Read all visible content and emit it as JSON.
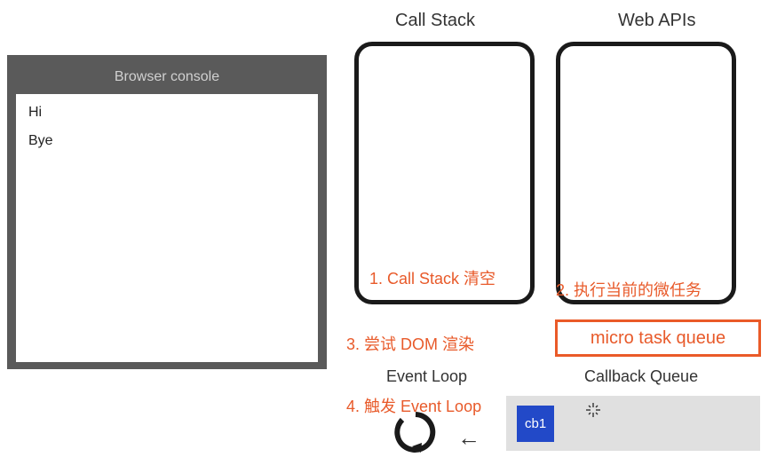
{
  "console": {
    "header": "Browser console",
    "lines": [
      "Hi",
      "Bye"
    ]
  },
  "labels": {
    "callstack": "Call Stack",
    "webapis": "Web APIs",
    "eventloop": "Event Loop",
    "callbackqueue": "Callback Queue"
  },
  "annotations": {
    "step1": "1. Call Stack 清空",
    "step2": "2. 执行当前的微任务",
    "step3": "3. 尝试 DOM 渲染",
    "step4": "4. 触发 Event Loop"
  },
  "microtask_label": "micro task queue",
  "callback_queue": {
    "items": [
      "cb1"
    ]
  },
  "colors": {
    "accent": "#e85a2a",
    "cb_bg": "#2249c8",
    "console_frame": "#5a5a5a"
  }
}
